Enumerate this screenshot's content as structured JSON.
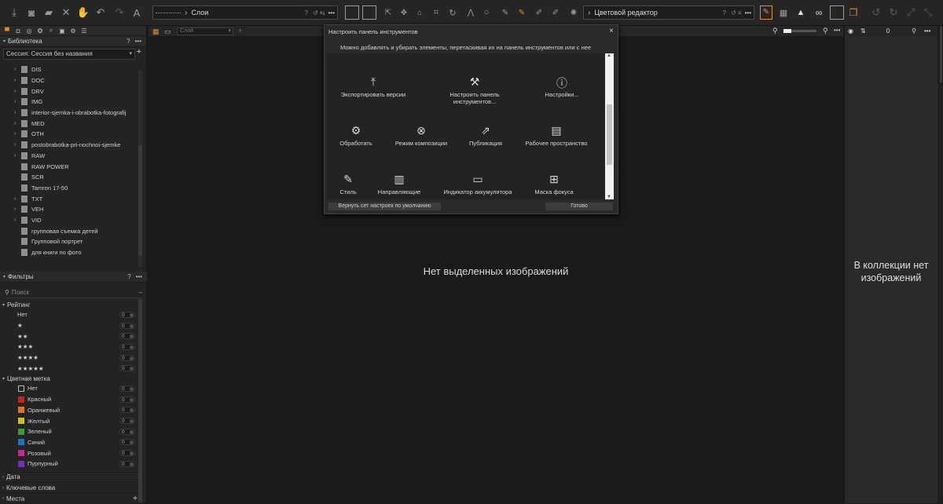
{
  "toolbar": {
    "layers_label": "Слои",
    "layers_help": "?",
    "color_editor_label": "Цветовой редактор",
    "color_editor_help": "?"
  },
  "view_bar": {
    "layer_select": "Слой",
    "zoom_value": "0"
  },
  "library": {
    "title": "Библиотека",
    "help": "?",
    "session": "Сессия: Сессия без названия",
    "folders": [
      {
        "name": "DIS",
        "expandable": true
      },
      {
        "name": "DOC",
        "expandable": true
      },
      {
        "name": "DRV",
        "expandable": true
      },
      {
        "name": "IMG",
        "expandable": true
      },
      {
        "name": "interior-sjemka-i-obrabotka-fotografij",
        "expandable": true
      },
      {
        "name": "MED",
        "expandable": true
      },
      {
        "name": "OTH",
        "expandable": true
      },
      {
        "name": "postobrabotka-pri-nochnoi-sjemke",
        "expandable": true
      },
      {
        "name": "RAW",
        "expandable": true
      },
      {
        "name": "RAW POWER",
        "expandable": false
      },
      {
        "name": "SCR",
        "expandable": false
      },
      {
        "name": "Tamron 17-50",
        "expandable": false
      },
      {
        "name": "TXT",
        "expandable": true
      },
      {
        "name": "VEH",
        "expandable": true
      },
      {
        "name": "VID",
        "expandable": true
      },
      {
        "name": "групповая съемка детей",
        "expandable": false
      },
      {
        "name": "Групповой портрет",
        "expandable": false
      },
      {
        "name": "для книги по фото",
        "expandable": false
      }
    ]
  },
  "filters": {
    "title": "Фильтры",
    "help": "?",
    "search_placeholder": "Поиск",
    "rating_title": "Рейтинг",
    "ratings": [
      {
        "label": "Нет",
        "count": "0"
      },
      {
        "label": "★",
        "count": "0"
      },
      {
        "label": "★★",
        "count": "0"
      },
      {
        "label": "★★★",
        "count": "0"
      },
      {
        "label": "★★★★",
        "count": "0"
      },
      {
        "label": "★★★★★",
        "count": "0"
      }
    ],
    "color_title": "Цветная метка",
    "colors": [
      {
        "label": "Нет",
        "color": "none",
        "count": "0"
      },
      {
        "label": "Красный",
        "color": "#c4221b",
        "count": "0"
      },
      {
        "label": "Оранжевый",
        "color": "#d6791c",
        "count": "0"
      },
      {
        "label": "Желтый",
        "color": "#cfc41c",
        "count": "0"
      },
      {
        "label": "Зеленый",
        "color": "#3a9c2e",
        "count": "0"
      },
      {
        "label": "Синий",
        "color": "#2270c4",
        "count": "0"
      },
      {
        "label": "Розовый",
        "color": "#c42a86",
        "count": "0"
      },
      {
        "label": "Пурпурный",
        "color": "#7a2ac4",
        "count": "0"
      }
    ],
    "collapsed": [
      "Дата",
      "Ключевые слова",
      "Места"
    ]
  },
  "viewer": {
    "empty_message": "Нет выделенных изображений"
  },
  "browser": {
    "empty_message": "В коллекции нет изображений"
  },
  "dialog": {
    "title": "Настроить панель инструментов",
    "close": "×",
    "hint": "Можно добавлять и убирать элементы, перетаскивая их на панель инструментов или с нее",
    "items": [
      {
        "label": "Экспортировать версии",
        "icon": "export-icon"
      },
      {
        "label": "Настроить панель инструментов...",
        "icon": "tools-icon"
      },
      {
        "label": "Настройки...",
        "icon": "info-icon"
      },
      {
        "label": "Обработать",
        "icon": "gear-icon"
      },
      {
        "label": "Режим композиции",
        "icon": "composition-icon"
      },
      {
        "label": "Публикация",
        "icon": "publish-icon"
      },
      {
        "label": "Рабочее пространство",
        "icon": "workspace-icon"
      },
      {
        "label": "Стиль",
        "icon": "brush-icon"
      },
      {
        "label": "Направляющие",
        "icon": "guides-icon"
      },
      {
        "label": "Индикатор аккумулятора",
        "icon": "battery-icon"
      },
      {
        "label": "Маска фокуса",
        "icon": "focus-mask-icon"
      }
    ],
    "reset_button": "Вернуть сет настроек по умолчанию",
    "done_button": "Готово"
  }
}
